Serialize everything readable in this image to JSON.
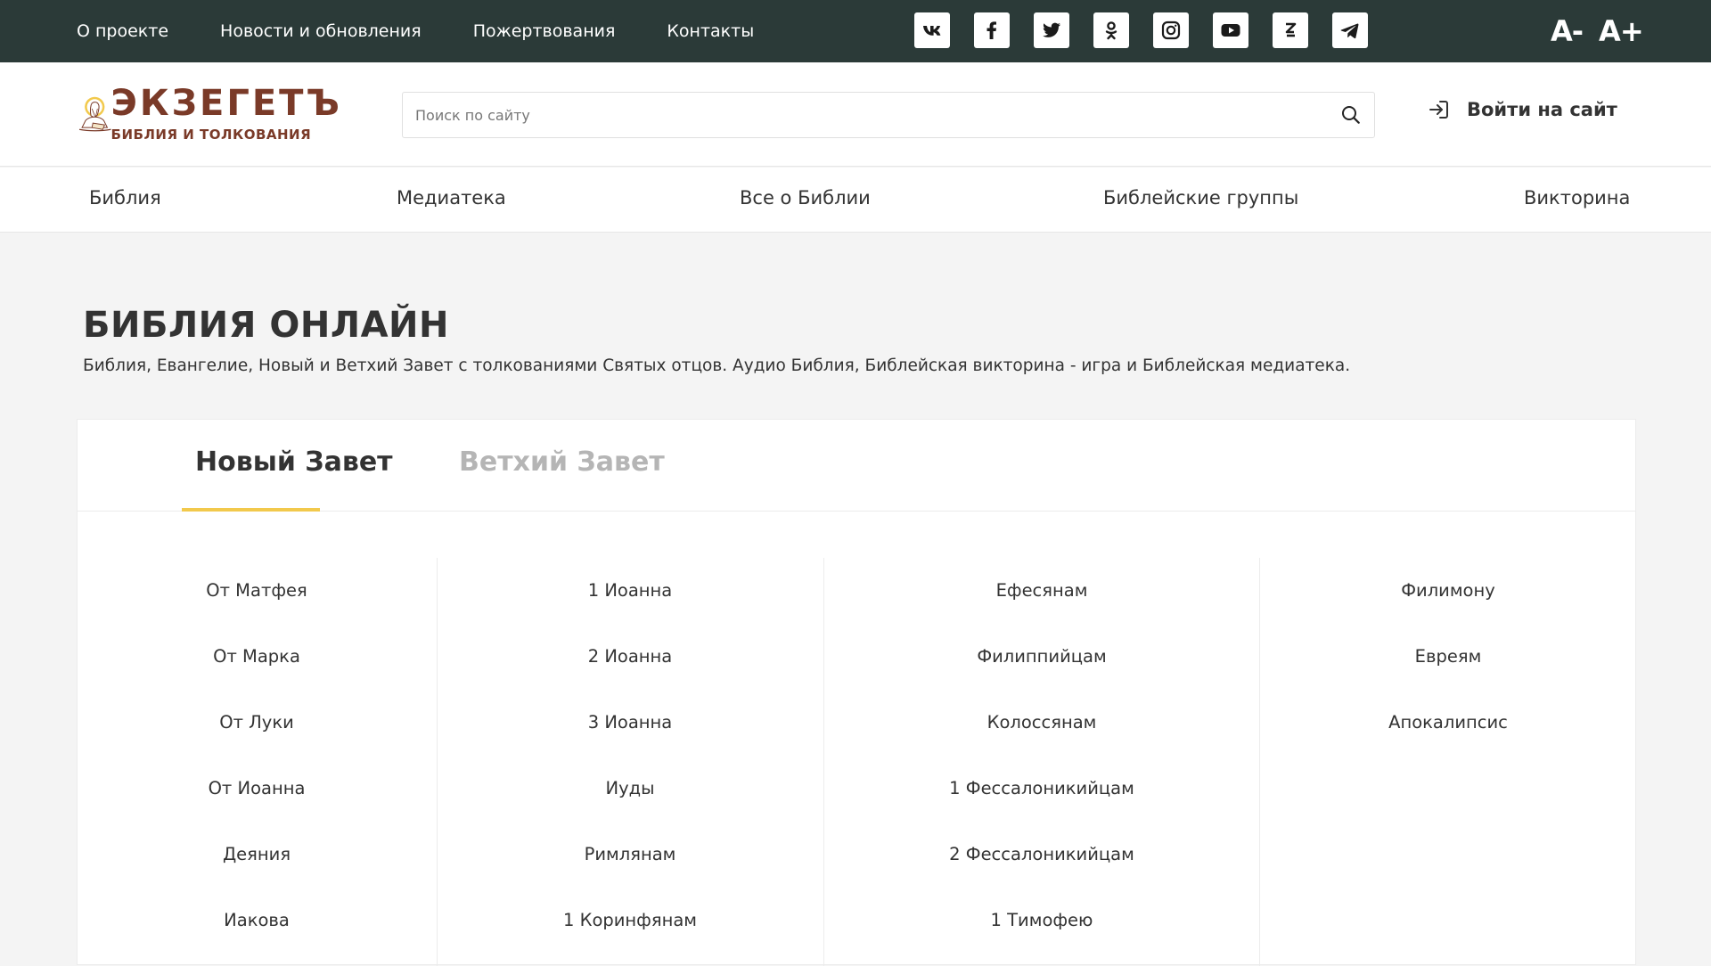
{
  "topbar": {
    "nav": [
      "О проекте",
      "Новости и обновления",
      "Пожертвования",
      "Контакты"
    ],
    "socials": [
      "vk-icon",
      "facebook-icon",
      "twitter-icon",
      "odnoklassniki-icon",
      "instagram-icon",
      "youtube-icon",
      "zen-icon",
      "telegram-icon"
    ],
    "font_decrease": "A-",
    "font_increase": "A+"
  },
  "header": {
    "logo_title": "ЭКЗЕГЕТЪ",
    "logo_subtitle": "БИБЛИЯ И ТОЛКОВАНИЯ",
    "search_placeholder": "Поиск по сайту",
    "login_label": "Войти на сайт"
  },
  "mainnav": [
    "Библия",
    "Медиатека",
    "Все о Библии",
    "Библейские группы",
    "Викторина"
  ],
  "page": {
    "title": "БИБЛИЯ ОНЛАЙН",
    "description": "Библия, Евангелие, Новый и Ветхий Завет с толкованиями Святых отцов. Аудио Библия, Библейская викторина - игра и Библейская медиатека."
  },
  "tabs": {
    "active": "Новый Завет",
    "inactive": "Ветхий Завет"
  },
  "books": {
    "col1": [
      "От Матфея",
      "От Марка",
      "От Луки",
      "От Иоанна",
      "Деяния",
      "Иакова"
    ],
    "col2": [
      "1 Иоанна",
      "2 Иоанна",
      "3 Иоанна",
      "Иуды",
      "Римлянам",
      "1 Коринфянам"
    ],
    "col3": [
      "Ефесянам",
      "Филиппийцам",
      "Колоссянам",
      "1 Фессалоникийцам",
      "2 Фессалоникийцам",
      "1 Тимофею"
    ],
    "col4": [
      "Филимону",
      "Евреям",
      "Апокалипсис"
    ]
  },
  "colors": {
    "topbar_bg": "#2b3a38",
    "accent": "#f2c94c",
    "brand": "#7a3a28"
  }
}
